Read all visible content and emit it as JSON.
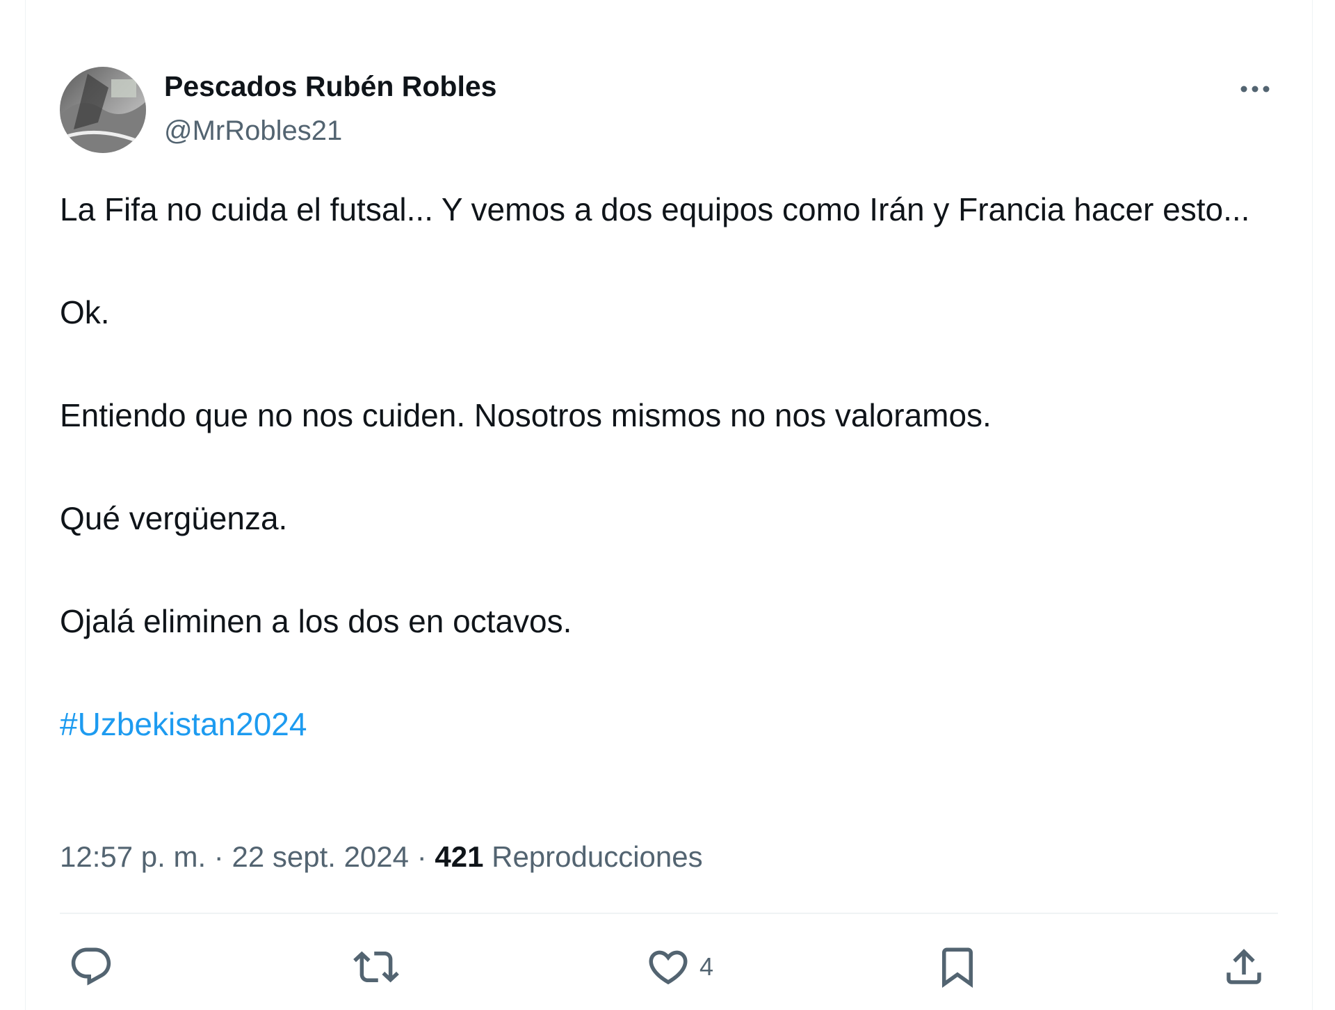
{
  "author": {
    "display_name": "Pescados Rubén Robles",
    "handle": "@MrRobles21",
    "avatar_icon": "profile-photo"
  },
  "more_icon": "more-dots-icon",
  "tweet": {
    "paragraphs": [
      "La Fifa no cuida el futsal... Y vemos a dos equipos como Irán y Francia hacer esto...",
      "Ok.",
      "Entiendo que no nos cuiden. Nosotros mismos no nos valoramos.",
      "Qué vergüenza.",
      "Ojalá eliminen a los dos en octavos."
    ],
    "hashtag": "#Uzbekistan2024",
    "hashtag_color": "#1d9bf0"
  },
  "meta": {
    "time": "12:57 p. m.",
    "separator": "·",
    "date": "22 sept. 2024",
    "views_count": "421",
    "views_label": "Reproducciones"
  },
  "actions": {
    "reply": {
      "icon": "reply-icon"
    },
    "retweet": {
      "icon": "retweet-icon"
    },
    "like": {
      "icon": "heart-icon",
      "count": "4"
    },
    "bookmark": {
      "icon": "bookmark-icon"
    },
    "share": {
      "icon": "share-icon"
    }
  },
  "colors": {
    "text_primary": "#0f1419",
    "text_secondary": "#536471",
    "divider": "#eff3f4",
    "link": "#1d9bf0"
  }
}
